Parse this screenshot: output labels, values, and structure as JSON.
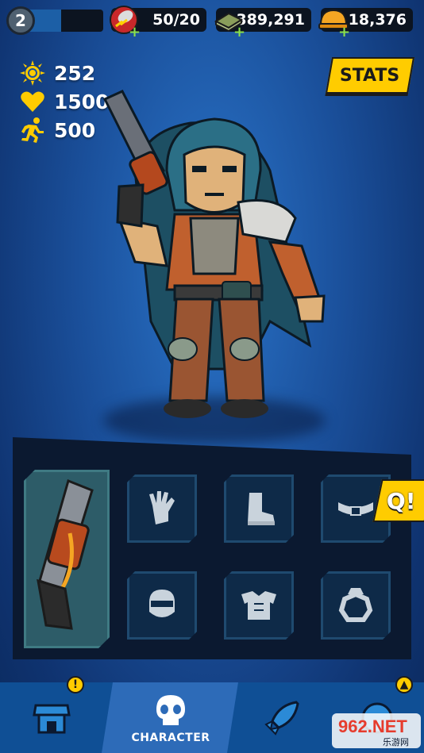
{
  "topbar": {
    "level": "2",
    "xp_fraction": 0.45,
    "energy": "50/20",
    "cash": "389,291",
    "gold": "18,376",
    "icons": [
      "lightning-bottle-icon",
      "cash-stack-icon",
      "gold-helmet-icon"
    ]
  },
  "stats": {
    "power": "252",
    "health": "1500",
    "speed": "500",
    "button_label": "STATS"
  },
  "equipment": {
    "slots": [
      {
        "name": "weapon-slot",
        "icon": "revolver-icon",
        "equipped": true
      },
      {
        "name": "gloves-slot",
        "icon": "glove-icon"
      },
      {
        "name": "boots-slot",
        "icon": "boot-icon"
      },
      {
        "name": "belt-slot",
        "icon": "belt-icon"
      },
      {
        "name": "helmet-slot",
        "icon": "mask-icon"
      },
      {
        "name": "armor-slot",
        "icon": "armor-icon"
      },
      {
        "name": "ring-slot",
        "icon": "ring-icon"
      }
    ],
    "quest_tag": "Q!"
  },
  "nav": {
    "tabs": [
      {
        "name": "shop",
        "icon": "shop-icon"
      },
      {
        "name": "character",
        "icon": "skull-icon",
        "label": "CHARACTER",
        "active": true
      },
      {
        "name": "missions",
        "icon": "rocket-icon"
      }
    ],
    "alert_glyph": "!",
    "up_glyph": "▲"
  },
  "watermark": {
    "text": "962.NET",
    "subtext": "乐游网"
  },
  "colors": {
    "accent": "#ffcc00",
    "panel": "#0b1930",
    "nav": "#0f4f95",
    "nav_active": "#2d6bb8"
  }
}
